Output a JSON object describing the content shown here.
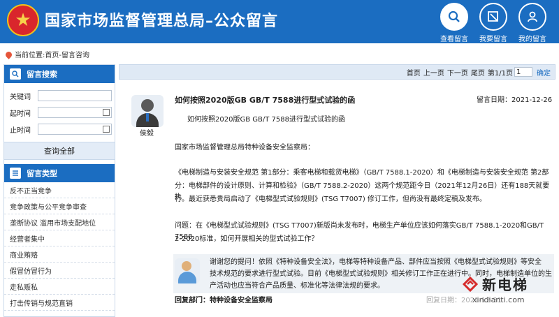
{
  "header": {
    "emblem_icon": "national-emblem-icon",
    "title": "国家市场监督管理总局–公众留言",
    "nav": [
      {
        "label": "查看留言",
        "icon": "search-icon",
        "active": true
      },
      {
        "label": "我要留言",
        "icon": "edit-icon",
        "active": false
      },
      {
        "label": "我的留言",
        "icon": "user-icon",
        "active": false
      }
    ]
  },
  "breadcrumb": "当前位置:首页-留言咨询",
  "sidebar": {
    "search_title": "留言搜索",
    "fields": [
      {
        "label": "关键词",
        "value": ""
      },
      {
        "label": "起时间",
        "value": ""
      },
      {
        "label": "止时间",
        "value": ""
      }
    ],
    "query_button": "查询全部",
    "types_title": "留言类型",
    "types": [
      "反不正当竞争",
      "竞争政策与公平竞争审查",
      "垄断协议 滥用市场支配地位",
      "经营者集中",
      "商业贿赂",
      "假冒仿冒行为",
      "走私贩私",
      "打击传销与规范直销"
    ]
  },
  "pager": {
    "first": "首页",
    "prev": "上一页",
    "next": "下一页",
    "last": "尾页",
    "page_info": "第1/1页",
    "page_input": "1",
    "confirm": "确定"
  },
  "message": {
    "author": "侯毅",
    "title": "如何按照2020版GB GB/T 7588进行型式试验的函",
    "date": "留言日期：2021-12-26",
    "subtitle": "如何按照2020版GB GB/T 7588进行型式试验的函",
    "addressee": "国家市场监督管理总局特种设备安全监察局：",
    "body_lines": [
      "《电梯制造与安装安全规范 第1部分：乘客电梯和载货电梯》（GB/T 7588.1-2020）和《电梯制造与安装安全规范 第2部",
      "分：电梯部件的设计原则、计算和检验》（GB/T 7588.2-2020）这两个规范距今日（2021年12月26日）还有188天就要执",
      "行。最近获悉贵局启动了《电梯型式试验规则》(TSG T7007) 修订工作，但尚没有最终定稿及发布。"
    ],
    "question_lines": [
      "问题：在《电梯型式试验规则》(TSG T7007)新版尚未发布时，电梯生产单位应该如何落实GB/T 7588.1-2020和GB/T 7588.",
      "2-2020标准，如何开展相关的型式试验工作？"
    ]
  },
  "reply": {
    "lines": [
      "谢谢您的提问！依照《特种设备安全法》，电梯等特种设备产品、部件应当按照《电梯型式试验规则》等安全",
      "技术规范的要求进行型式试验。目前《电梯型式试验规则》相关修订工作正在进行中。同时，电梯制造单位的生",
      "产活动也应当符合产品质量、标准化等法律法规的要求。"
    ],
    "dept": "回复部门：特种设备安全监察局",
    "date_partial": "回复日期：2021-12-31"
  },
  "watermark": {
    "name": "新电梯",
    "url": "xindianti.com"
  }
}
